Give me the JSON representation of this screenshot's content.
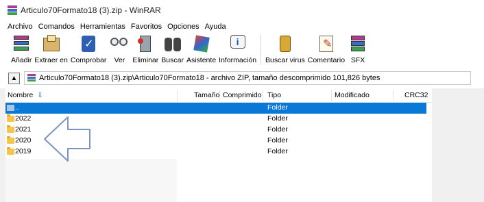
{
  "window": {
    "title": "Articulo70Formato18 (3).zip - WinRAR"
  },
  "menu": [
    "Archivo",
    "Comandos",
    "Herramientas",
    "Favoritos",
    "Opciones",
    "Ayuda"
  ],
  "toolbar": [
    {
      "label": "Añadir",
      "icon": "add-archive-icon"
    },
    {
      "label": "Extraer en",
      "icon": "extract-to-icon"
    },
    {
      "label": "Comprobar",
      "icon": "test-icon"
    },
    {
      "label": "Ver",
      "icon": "view-icon"
    },
    {
      "label": "Eliminar",
      "icon": "delete-icon"
    },
    {
      "label": "Buscar",
      "icon": "find-icon"
    },
    {
      "label": "Asistente",
      "icon": "wizard-icon"
    },
    {
      "label": "Información",
      "icon": "info-icon"
    },
    {
      "label": "Buscar virus",
      "icon": "virus-scan-icon"
    },
    {
      "label": "Comentario",
      "icon": "comment-icon"
    },
    {
      "label": "SFX",
      "icon": "sfx-icon"
    }
  ],
  "address": {
    "path": "Articulo70Formato18 (3).zip\\Articulo70Formato18 - archivo ZIP, tamaño descomprimido 101,826 bytes"
  },
  "columns": {
    "name": "Nombre",
    "size": "Tamaño",
    "compressed": "Comprimido",
    "type": "Tipo",
    "modified": "Modificado",
    "crc": "CRC32"
  },
  "files": [
    {
      "name": "..",
      "type": "Folder",
      "selected": true
    },
    {
      "name": "2022",
      "type": "Folder"
    },
    {
      "name": "2021",
      "type": "Folder"
    },
    {
      "name": "2020",
      "type": "Folder"
    },
    {
      "name": "2019",
      "type": "Folder"
    }
  ],
  "colors": {
    "selection": "#0a78d7",
    "annotation_arrow": "#7a95c0"
  }
}
